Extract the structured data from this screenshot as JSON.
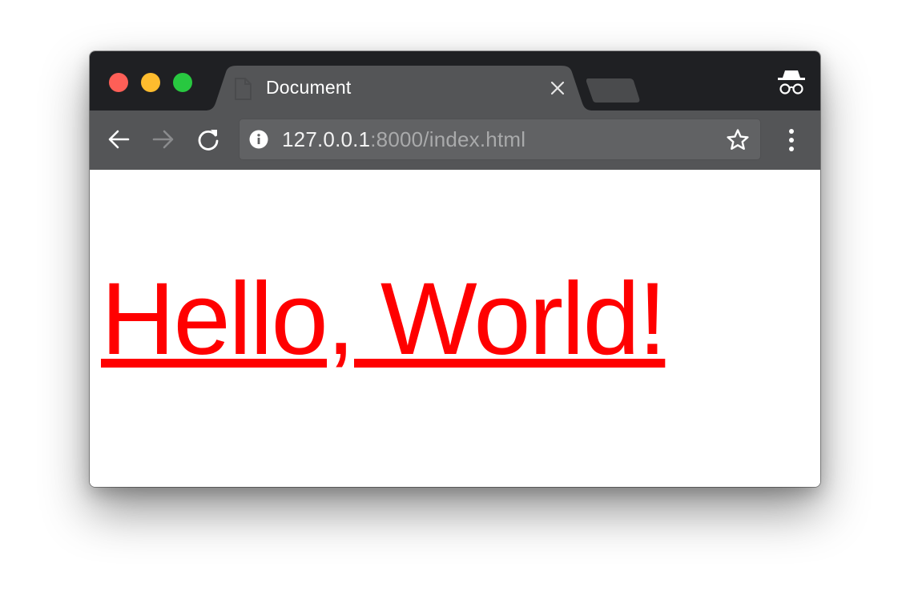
{
  "window": {
    "controls": [
      "close",
      "minimize",
      "maximize"
    ]
  },
  "tab": {
    "title": "Document",
    "favicon": "document-icon",
    "close_icon": "close-icon"
  },
  "new_tab": {
    "icon": "new-tab-icon"
  },
  "incognito": {
    "icon": "incognito-icon"
  },
  "toolbar": {
    "back_icon": "arrow-left-icon",
    "forward_icon": "arrow-right-icon",
    "reload_icon": "reload-icon",
    "address": {
      "info_icon": "info-icon",
      "host": "127.0.0.1",
      "rest": ":8000/index.html"
    },
    "bookmark_icon": "star-icon",
    "menu_icon": "more-vert-icon"
  },
  "page": {
    "heading": "Hello, World!",
    "heading_color": "#ff0000"
  },
  "colors": {
    "tabstrip": "#1f2023",
    "toolbar": "#545557",
    "omnibox": "#616264",
    "close": "#fe5f57",
    "minimize": "#febc2e",
    "maximize": "#28c840"
  }
}
